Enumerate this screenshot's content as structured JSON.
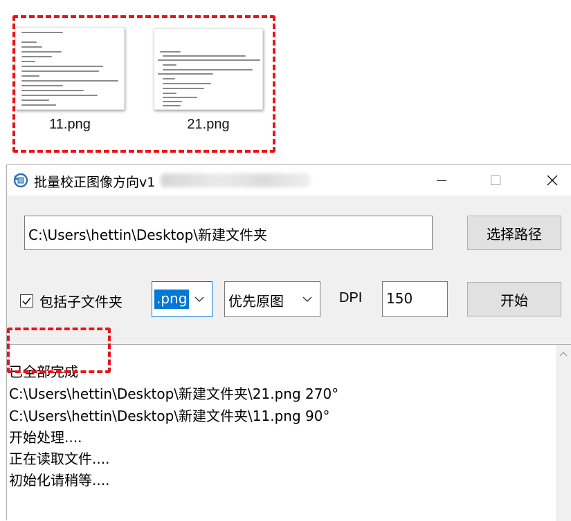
{
  "explorer": {
    "files": [
      {
        "name": "11.png"
      },
      {
        "name": "21.png"
      }
    ],
    "highlight_color": "#e8141a"
  },
  "window": {
    "title": "批量校正图像方向v1",
    "app_icon": "rotate-icon",
    "controls": {
      "minimize": "minimize-icon",
      "maximize": "maximize-icon",
      "close": "close-icon"
    }
  },
  "path": {
    "value": "C:\\Users\\hettin\\Desktop\\新建文件夹"
  },
  "browse_button": {
    "label": "选择路径"
  },
  "include_subfolders": {
    "label": "包括子文件夹",
    "checked": true
  },
  "extension_select": {
    "value": ".png"
  },
  "mode_select": {
    "value": "优先原图"
  },
  "dpi": {
    "label": "DPI",
    "value": "150"
  },
  "start_button": {
    "label": "开始"
  },
  "log": {
    "lines": [
      "已全部完成",
      "C:\\Users\\hettin\\Desktop\\新建文件夹\\21.png  270°",
      "C:\\Users\\hettin\\Desktop\\新建文件夹\\11.png  90°",
      "开始处理....",
      "正在读取文件....",
      "初始化请稍等...."
    ]
  },
  "colors": {
    "accent": "#0078d7",
    "window_bg": "#f0f0f0",
    "annotation": "#e8141a"
  }
}
